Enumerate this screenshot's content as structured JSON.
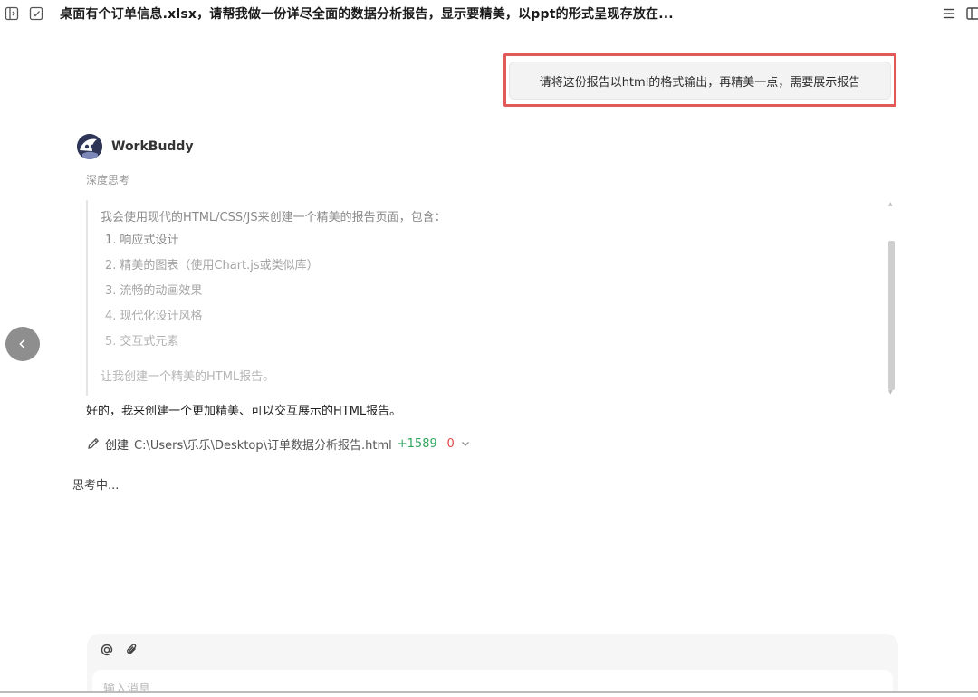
{
  "header": {
    "title": "桌面有个订单信息.xlsx，请帮我做一份详尽全面的数据分析报告，显示要精美，以ppt的形式呈现存放在..."
  },
  "user_message": {
    "text": "请将这份报告以html的格式输出，再精美一点，需要展示报告"
  },
  "assistant": {
    "name": "WorkBuddy",
    "deep_think_label": "深度思考",
    "thinking": {
      "intro": "我会使用现代的HTML/CSS/JS来创建一个精美的报告页面，包含：",
      "items": [
        {
          "n": "1.",
          "text": "响应式设计",
          "color": "#8a8a8a"
        },
        {
          "n": "2.",
          "text": "精美的图表（使用Chart.js或类似库）",
          "color": "#a3a3a3"
        },
        {
          "n": "3.",
          "text": "流畅的动画效果",
          "color": "#a3a3a3"
        },
        {
          "n": "4.",
          "text": "现代化设计风格",
          "color": "#adadad"
        },
        {
          "n": "5.",
          "text": "交互式元素",
          "color": "#b3b3b3"
        }
      ],
      "outro": "让我创建一个精美的HTML报告。"
    },
    "reply": "好的，我来创建一个更加精美、可以交互展示的HTML报告。",
    "file_action": {
      "action": "创建",
      "path": "C:\\Users\\乐乐\\Desktop\\订单数据分析报告.html",
      "added": "+1589",
      "removed": "-0"
    },
    "status": "思考中..."
  },
  "composer": {
    "placeholder": "输入消息"
  },
  "colors": {
    "highlight_border": "#e05a5a",
    "added": "#2fa760",
    "removed": "#e04848"
  }
}
